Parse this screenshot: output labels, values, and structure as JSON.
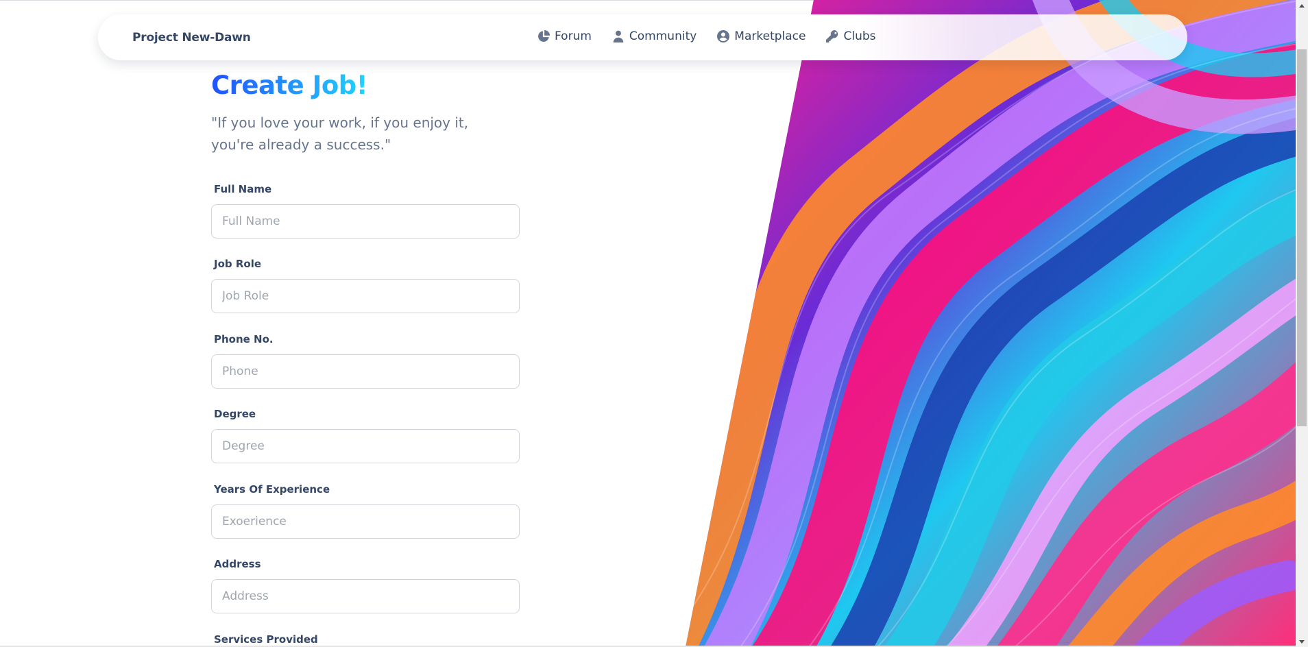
{
  "navbar": {
    "brand": "Project New-Dawn",
    "links": [
      {
        "label": "Forum",
        "icon": "pie-chart-icon"
      },
      {
        "label": "Community",
        "icon": "user-icon"
      },
      {
        "label": "Marketplace",
        "icon": "user-circle-icon"
      },
      {
        "label": "Clubs",
        "icon": "key-icon"
      }
    ]
  },
  "form": {
    "title": "Create Job!",
    "quote": "\"If you love your work, if you enjoy it, you're already a success.\"",
    "fields": [
      {
        "label": "Full Name",
        "placeholder": "Full Name",
        "value": ""
      },
      {
        "label": "Job Role",
        "placeholder": "Job Role",
        "value": ""
      },
      {
        "label": "Phone No.",
        "placeholder": "Phone",
        "value": ""
      },
      {
        "label": "Degree",
        "placeholder": "Degree",
        "value": ""
      },
      {
        "label": "Years Of Experience",
        "placeholder": "Exoerience",
        "value": ""
      },
      {
        "label": "Address",
        "placeholder": "Address",
        "value": ""
      },
      {
        "label": "Services Provided"
      }
    ]
  },
  "colors": {
    "title_gradient_start": "#2152ff",
    "title_gradient_end": "#21d4fd",
    "text_dark": "#344767",
    "text_muted": "#67748e"
  }
}
